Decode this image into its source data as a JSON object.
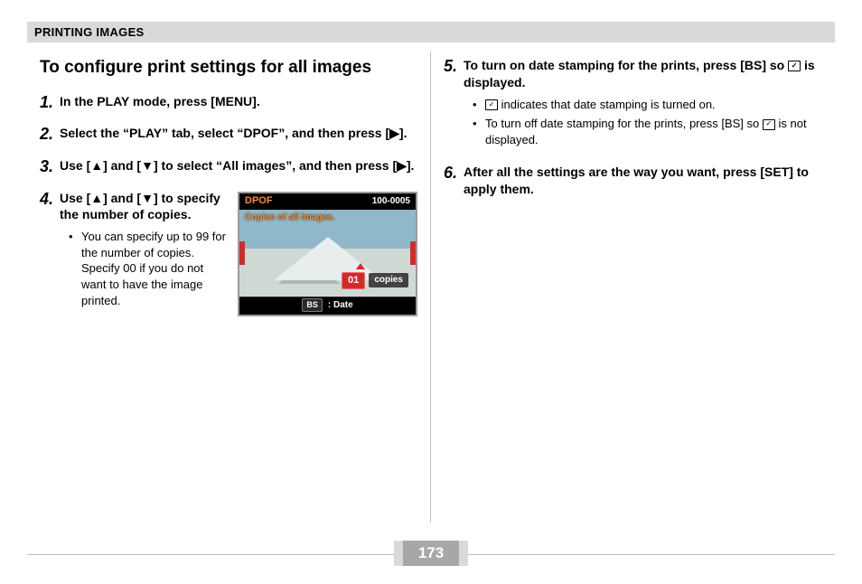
{
  "header": {
    "section_title": "PRINTING IMAGES"
  },
  "left": {
    "subtitle": "To configure print settings for all images",
    "steps": [
      {
        "n": "1.",
        "text": "In the PLAY mode, press [MENU]."
      },
      {
        "n": "2.",
        "text": "Select the “PLAY” tab, select “DPOF”, and then press [▶]."
      },
      {
        "n": "3.",
        "text": "Use [▲] and [▼] to select “All images”, and then press [▶]."
      }
    ],
    "step4": {
      "n": "4.",
      "text": "Use [▲] and [▼] to specify the number of copies.",
      "bullet": "You can specify up to 99 for the number of copies. Specify 00 if you do not want to have the image printed."
    },
    "camera": {
      "top_left": "DPOF",
      "top_right": "100-0005",
      "caption": "Copies of all images.",
      "copies_value": "01",
      "copies_label": "copies",
      "bottom_bs": "BS",
      "bottom_label": ": Date"
    }
  },
  "right": {
    "step5": {
      "n": "5.",
      "line1": "To turn on date stamping for the prints, press [BS] so ",
      "line2": " is displayed.",
      "bullet1_pre": "",
      "bullet1_post": " indicates that date stamping is turned on.",
      "bullet2_pre": "To turn off date stamping for the prints, press [BS] so ",
      "bullet2_post": " is not displayed."
    },
    "step6": {
      "n": "6.",
      "text": "After all the settings are the way you want, press [SET] to apply them."
    }
  },
  "icons": {
    "date_stamp_glyph": "✓"
  },
  "footer": {
    "page_number": "173"
  }
}
